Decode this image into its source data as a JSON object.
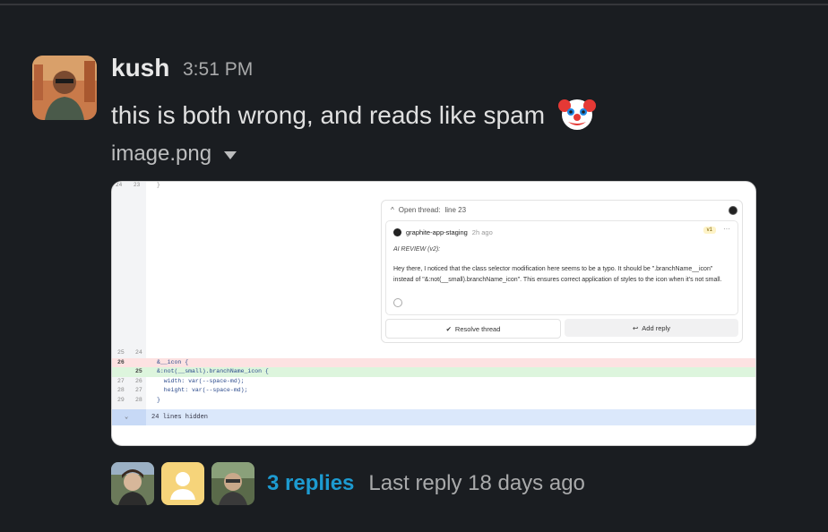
{
  "message": {
    "author": "kush",
    "time": "3:51 PM",
    "text": "this is both wrong, and reads like spam",
    "emoji": "clown-face",
    "attachment": {
      "filename": "image.png"
    }
  },
  "screenshot": {
    "top_line_numbers": [
      "24",
      "23"
    ],
    "top_code": "}",
    "thread": {
      "header": "Open thread:",
      "line": "line 23",
      "comment": {
        "author": "graphite-app-staging",
        "ago": "2h ago",
        "version": "v1",
        "more": "···",
        "title": "AI REVIEW (v2):",
        "body": "Hey there, I noticed that the class selector modification here seems to be a typo. It should be \".branchName__icon\" instead of \"&:not(__small).branchName_icon\". This ensures correct application of styles to the icon when it's not small."
      },
      "resolve_label": "Resolve thread",
      "reply_label": "Add reply"
    },
    "diff_lines": [
      {
        "a": "25",
        "b": "24",
        "code": "",
        "kind": "ctx"
      },
      {
        "a": "26",
        "b": "",
        "code": "&__icon {",
        "kind": "del"
      },
      {
        "a": "",
        "b": "25",
        "code": "&:not(__small).branchName_icon {",
        "kind": "add"
      },
      {
        "a": "27",
        "b": "26",
        "code": "  width: var(--space-md);",
        "kind": "ctx"
      },
      {
        "a": "28",
        "b": "27",
        "code": "  height: var(--space-md);",
        "kind": "ctx"
      },
      {
        "a": "29",
        "b": "28",
        "code": "}",
        "kind": "ctx"
      }
    ],
    "hidden_lines": "24 lines hidden"
  },
  "thread_summary": {
    "reply_count": "3 replies",
    "last_reply": "Last reply 18 days ago"
  },
  "colors": {
    "background": "#1a1d21",
    "link": "#1d9bd1",
    "diff_deleted": "#fde2e2",
    "diff_added": "#ddf5dd",
    "hidden_row": "#dbe8fb"
  }
}
